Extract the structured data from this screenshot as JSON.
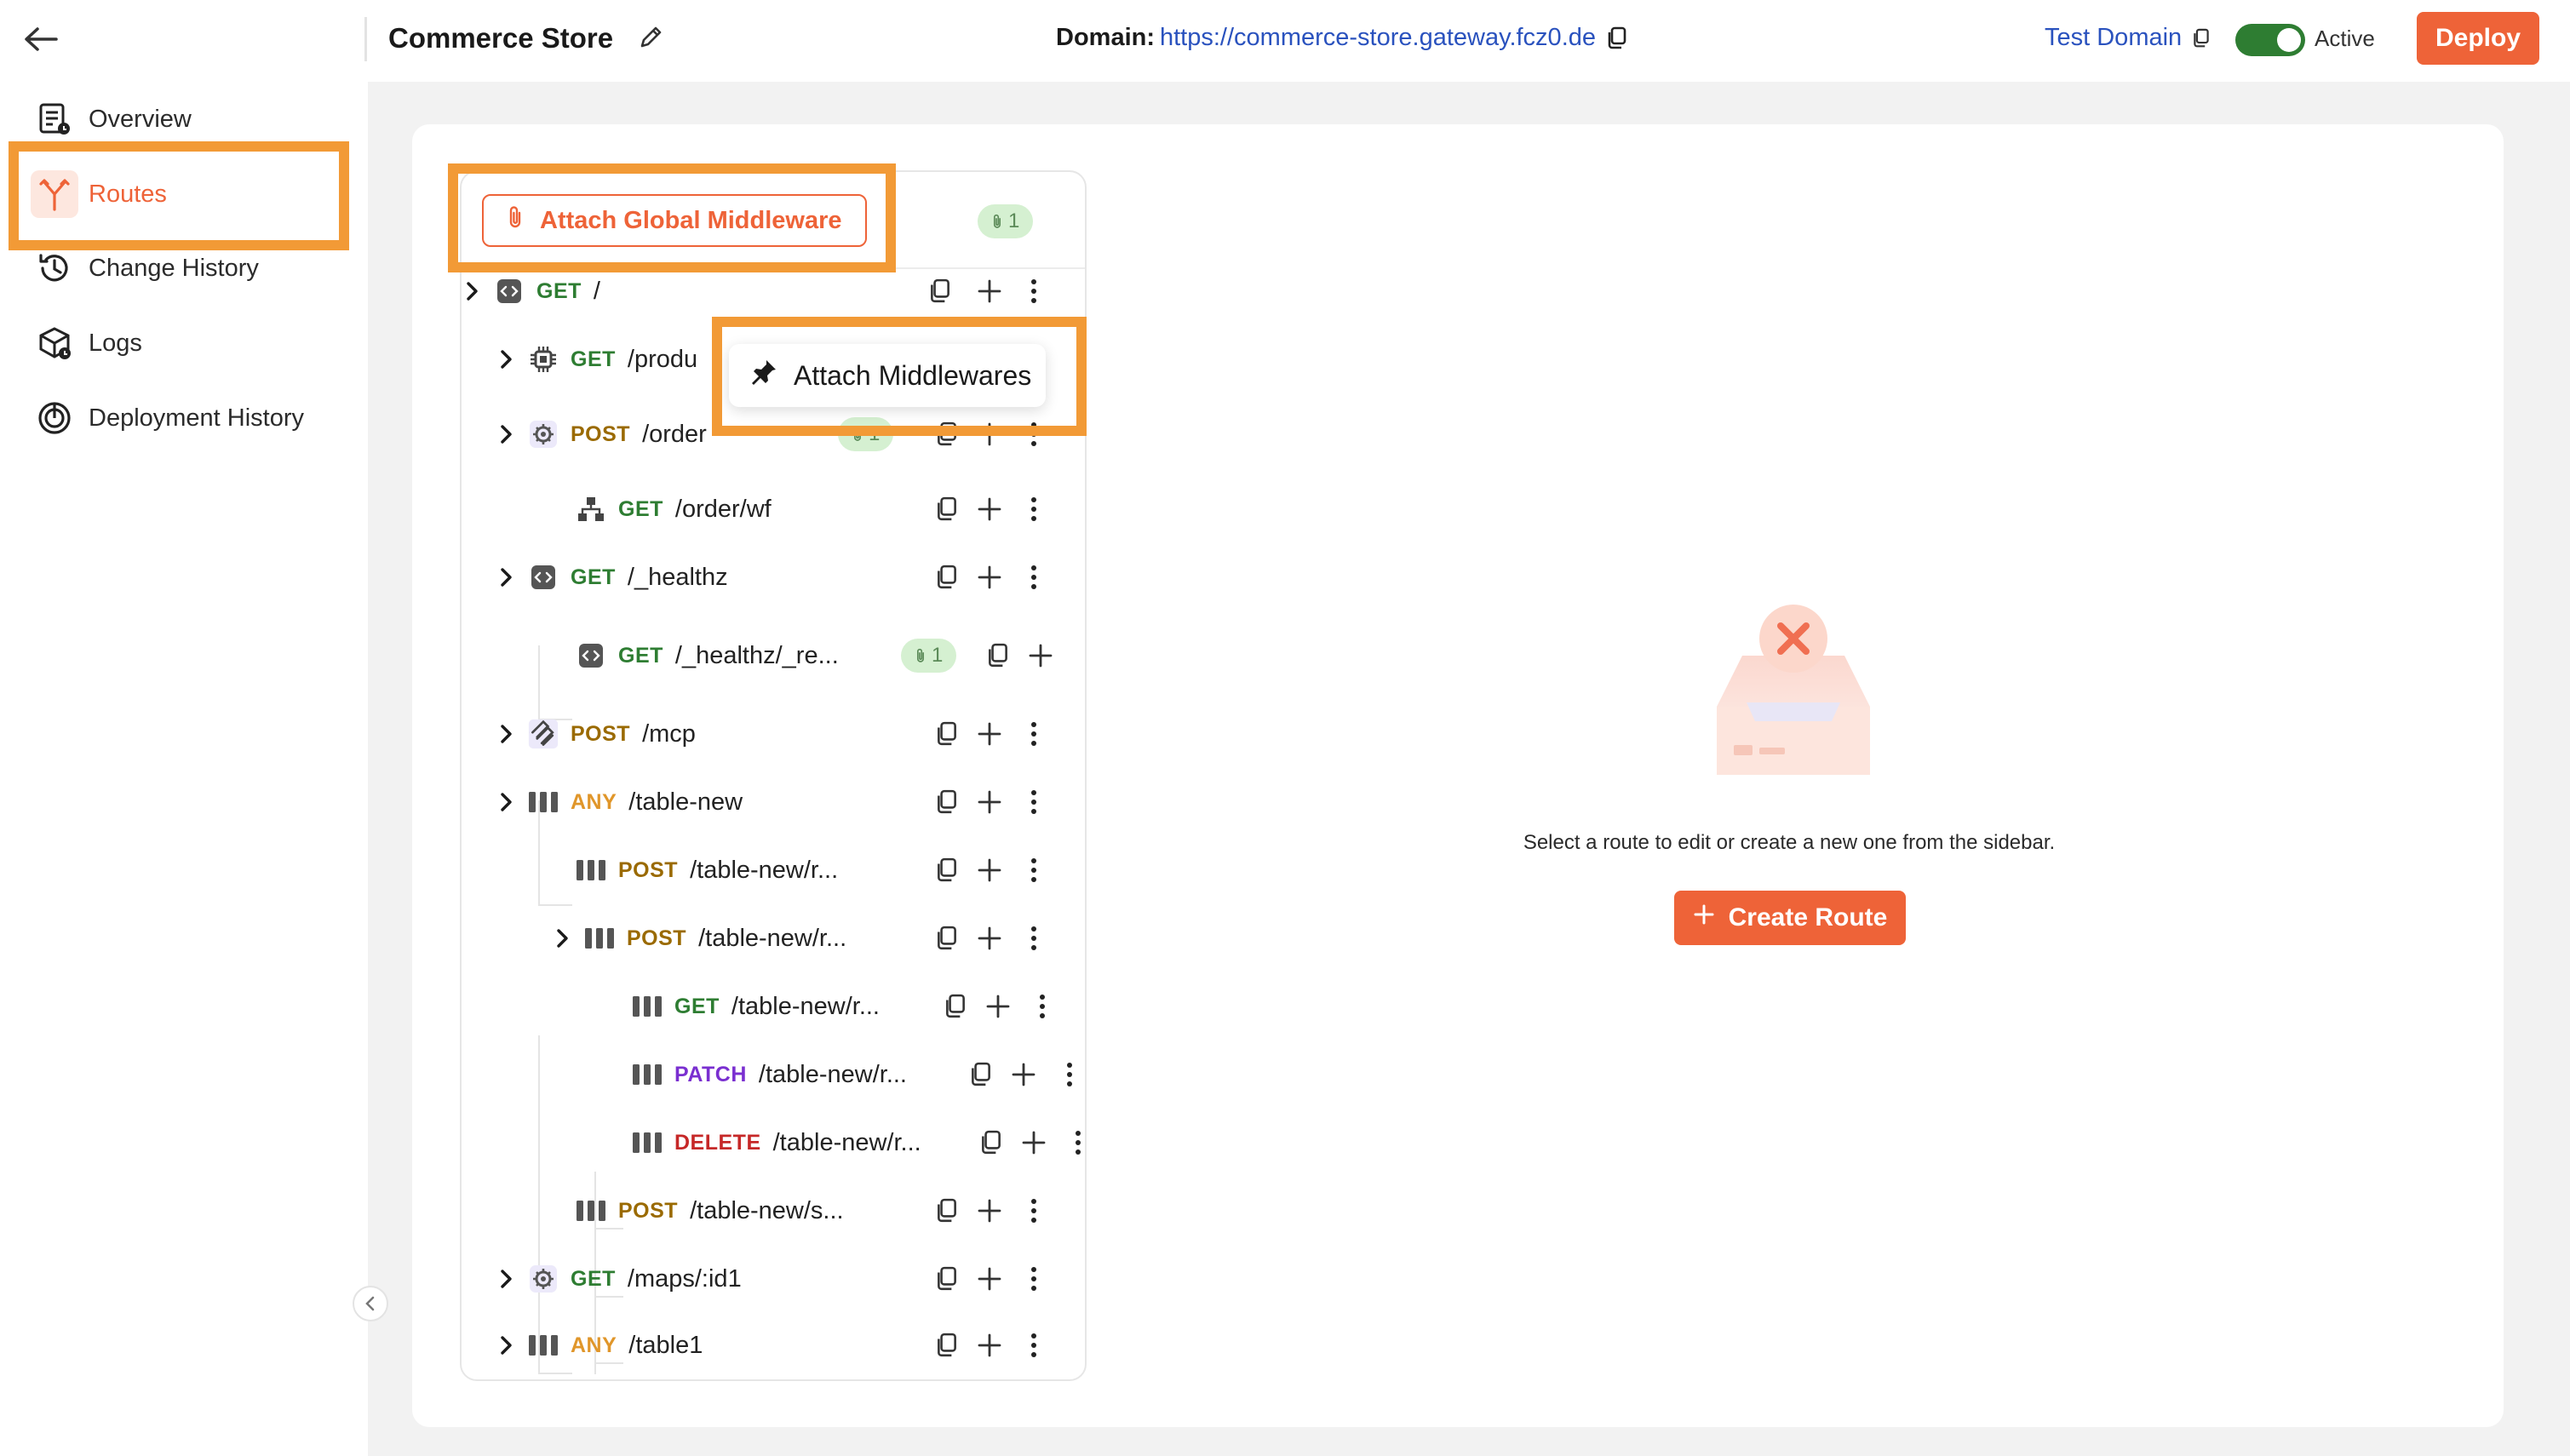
{
  "app": {
    "title": "Commerce Store",
    "domain_label": "Domain:",
    "domain_url": "https://commerce-store.gateway.fcz0.de",
    "test_domain_label": "Test Domain",
    "status_label": "Active",
    "deploy_label": "Deploy"
  },
  "sidebar": {
    "items": [
      {
        "label": "Overview",
        "icon": "overview-icon"
      },
      {
        "label": "Routes",
        "icon": "routes-icon",
        "active": true
      },
      {
        "label": "Change History",
        "icon": "history-icon"
      },
      {
        "label": "Logs",
        "icon": "logs-icon"
      },
      {
        "label": "Deployment History",
        "icon": "deployment-icon"
      }
    ]
  },
  "routes_panel": {
    "global_middleware_label": "Attach Global Middleware",
    "global_middleware_count": "1",
    "popup_label": "Attach Middlewares",
    "routes": [
      {
        "method": "GET",
        "path": "/",
        "icon": "code-icon"
      },
      {
        "method": "GET",
        "path": "/produ",
        "icon": "chip-icon"
      },
      {
        "method": "POST",
        "path": "/order",
        "icon": "gear-icon",
        "badge": "1"
      },
      {
        "method": "GET",
        "path": "/order/wf",
        "icon": "workflow-icon"
      },
      {
        "method": "GET",
        "path": "/_healthz",
        "icon": "code-icon"
      },
      {
        "method": "GET",
        "path": "/_healthz/_re...",
        "icon": "code-icon",
        "badge": "1"
      },
      {
        "method": "POST",
        "path": "/mcp",
        "icon": "mcp-icon"
      },
      {
        "method": "ANY",
        "path": "/table-new",
        "icon": "table-icon"
      },
      {
        "method": "POST",
        "path": "/table-new/r...",
        "icon": "table-icon"
      },
      {
        "method": "POST",
        "path": "/table-new/r...",
        "icon": "table-icon"
      },
      {
        "method": "GET",
        "path": "/table-new/r...",
        "icon": "table-icon"
      },
      {
        "method": "PATCH",
        "path": "/table-new/r...",
        "icon": "table-icon"
      },
      {
        "method": "DELETE",
        "path": "/table-new/r...",
        "icon": "table-icon"
      },
      {
        "method": "POST",
        "path": "/table-new/s...",
        "icon": "table-icon"
      },
      {
        "method": "GET",
        "path": "/maps/:id1",
        "icon": "gear-icon"
      },
      {
        "method": "ANY",
        "path": "/table1",
        "icon": "table-icon"
      }
    ]
  },
  "empty_state": {
    "message": "Select a route to edit or create a new one from the sidebar.",
    "create_label": "Create Route"
  },
  "colors": {
    "accent": "#ee6338",
    "highlight": "#f29a36",
    "toggle_on": "#2e7d32"
  }
}
